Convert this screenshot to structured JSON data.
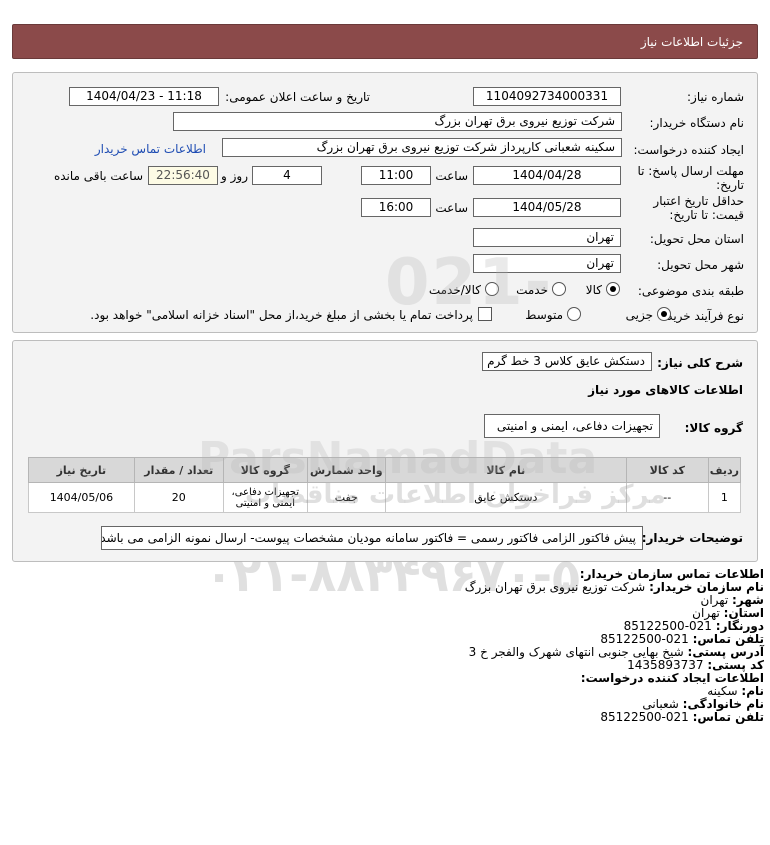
{
  "header": {
    "title": "جزئیات اطلاعات نیاز"
  },
  "form": {
    "need_number_label": "شماره نیاز:",
    "need_number": "1104092734000331",
    "announce_label": "تاریخ و ساعت اعلان عمومی:",
    "announce_value": "1404/04/23 - 11:18",
    "buyer_label": "نام دستگاه خریدار:",
    "buyer_value": "شرکت توزیع نیروی برق تهران بزرگ",
    "creator_label": "ایجاد کننده درخواست:",
    "creator_value": "سکینه شعبانی کارپرداز شرکت توزیع نیروی برق تهران بزرگ",
    "contact_link": "اطلاعات تماس خریدار",
    "deadline_label_1": "مهلت ارسال پاسخ: تا",
    "deadline_label_2": "تاریخ:",
    "deadline_date": "1404/04/28",
    "time_label": "ساعت",
    "deadline_time": "11:00",
    "days_value": "4",
    "days_label": "روز و",
    "remaining_value": "22:56:40",
    "remaining_label": "ساعت باقی مانده",
    "validity_label_1": "حداقل تاریخ اعتبار",
    "validity_label_2": "قیمت: تا تاریخ:",
    "validity_date": "1404/05/28",
    "validity_time": "16:00",
    "province_label": "استان محل تحویل:",
    "province_value": "تهران",
    "city_label": "شهر محل تحویل:",
    "city_value": "تهران",
    "category_label": "طبقه بندی موضوعی:",
    "category_options": [
      "کالا",
      "خدمت",
      "کالا/خدمت"
    ],
    "process_label": "نوع فرآیند خرید :",
    "process_options": [
      "جزیی",
      "متوسط"
    ],
    "payment_note": "پرداخت تمام یا بخشی از مبلغ خرید،از محل \"اسناد خزانه اسلامی\" خواهد بود."
  },
  "need": {
    "summary_label": "شرح کلی نیاز:",
    "summary_value": "دستکش عایق کلاس 3 خط گرم",
    "items_title": "اطلاعات کالاهای مورد نیاز",
    "group_label": "گروه کالا:",
    "group_value": "تجهیزات دفاعی، ایمنی و امنیتی",
    "table": {
      "headers": [
        "ردیف",
        "کد کالا",
        "نام کالا",
        "واحد شمارش",
        "گروه کالا",
        "تعداد / مقدار",
        "تاریخ نیاز"
      ],
      "rows": [
        [
          "1",
          "--",
          "دستکش عایق",
          "جفت",
          "تجهیزات دفاعی، ایمنی و امنیتی",
          "20",
          "1404/05/06"
        ]
      ]
    },
    "buyer_notes_label": "توضیحات خریدار:",
    "buyer_notes_value": "پیش فاکتور الزامی فاکتور رسمی = فاکتور سامانه مودیان مشخصات پیوست- ارسال نمونه الزامی می باشد"
  },
  "contact": {
    "section_title": "اطلاعات تماس سازمان خریدار:",
    "org_label": "نام سازمان خریدار:",
    "org_value": "شرکت توزیع نیروی برق تهران بزرگ",
    "city_label": "شهر:",
    "city_value": "تهران",
    "province_label": "استان:",
    "province_value": "تهران",
    "fax_label": "دورنگار:",
    "fax_value": "021-85122500",
    "phone_label": "تلفن تماس:",
    "phone_value": "021-85122500",
    "address_label": "آدرس پستی:",
    "address_value": "شیخ بهایی جنوبی انتهای شهرک والفجر خ 3",
    "postal_label": "کد پستی:",
    "postal_value": "1435893737",
    "creator_title": "اطلاعات ایجاد کننده درخواست:",
    "name_label": "نام:",
    "name_value": "سکینه",
    "family_label": "نام خانوادگی:",
    "family_value": "شعبانی",
    "creator_phone_label": "تلفن تماس:",
    "creator_phone_value": "021-85122500"
  },
  "watermark": {
    "numbers": "۰۲۱-۸۸۳۴۹۶۷۰-۵",
    "brand": "ParsNamadData",
    "phone_top": "021-88349670",
    "arabic": "مرکز فراخوان اطلاعات مناقصات"
  }
}
